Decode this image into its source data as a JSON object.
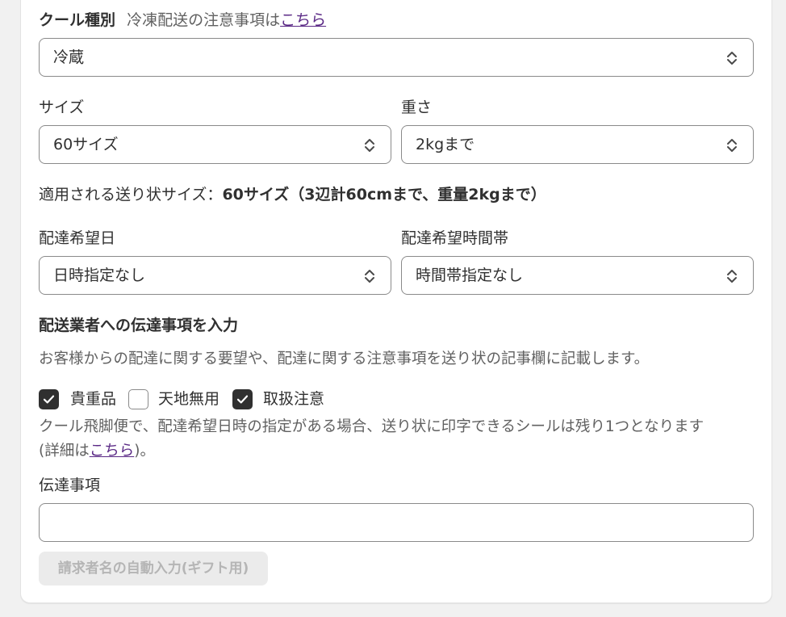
{
  "cool": {
    "label": "クール種別",
    "note_prefix": "冷凍配送の注意事項は",
    "note_link": "こちら",
    "select_value": "冷蔵"
  },
  "size": {
    "label": "サイズ",
    "select_value": "60サイズ"
  },
  "weight": {
    "label": "重さ",
    "select_value": "2kgまで"
  },
  "applied": {
    "prefix": "適用される送り状サイズ：",
    "value": "60サイズ（3辺計60cmまで、重量2kgまで）"
  },
  "delivery_date": {
    "label": "配達希望日",
    "select_value": "日時指定なし"
  },
  "delivery_time": {
    "label": "配達希望時間帯",
    "select_value": "時間帯指定なし"
  },
  "carrier_notes": {
    "heading": "配送業者への伝達事項を入力",
    "description": "お客様からの配達に関する要望や、配達に関する注意事項を送り状の記事欄に記載します。",
    "options": [
      {
        "label": "貴重品",
        "checked": true
      },
      {
        "label": "天地無用",
        "checked": false
      },
      {
        "label": "取扱注意",
        "checked": true
      }
    ],
    "warning_line1": "クール飛脚便で、配達希望日時の指定がある場合、送り状に印字できるシールは残り1つとなります",
    "warning_line2_prefix": "(詳細は",
    "warning_link": "こちら",
    "warning_line2_suffix": ")。",
    "message_label": "伝達事項",
    "message_value": "",
    "autofill_button": "請求者名の自動入力(ギフト用)"
  }
}
